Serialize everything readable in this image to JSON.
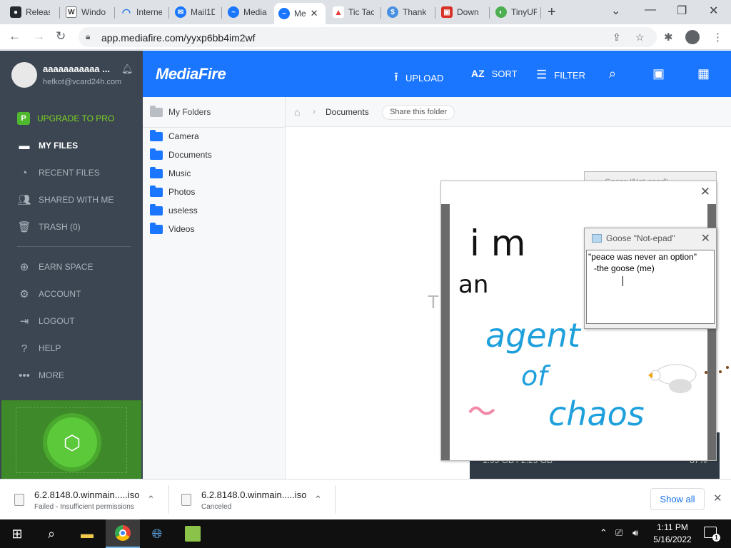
{
  "browser": {
    "tabs": [
      {
        "label": "Releas",
        "icon": "github-icon",
        "color": "#24292e"
      },
      {
        "label": "Windo",
        "icon": "wikipedia-icon",
        "color": "#555555"
      },
      {
        "label": "Interne",
        "icon": "loading-spinner-icon",
        "color": "#1a73e8"
      },
      {
        "label": "Mail1D",
        "icon": "mail-icon",
        "color": "#1a75ff"
      },
      {
        "label": "Media",
        "icon": "mediafire-icon",
        "color": "#1a75ff"
      },
      {
        "label": "Me",
        "icon": "mediafire-icon",
        "color": "#1a75ff"
      },
      {
        "label": "Tic Tac",
        "icon": "tictactoe-icon",
        "color": "#e8403a"
      },
      {
        "label": "Thank",
        "icon": "dollar-icon",
        "color": "#4a90e2"
      },
      {
        "label": "Down",
        "icon": "pdf-icon",
        "color": "#d93025"
      },
      {
        "label": "TinyUF",
        "icon": "tinyurl-icon",
        "color": "#4caf50"
      }
    ],
    "url": "app.mediafire.com/yyxp6bb4im2wf"
  },
  "user": {
    "name": "aaaaaaaaaaa ...",
    "email": "hefkot@vcard24h.com"
  },
  "sidebar": {
    "items": [
      {
        "label": "UPGRADE TO PRO",
        "icon": "pro-badge-icon"
      },
      {
        "label": "MY FILES",
        "icon": "folder-icon"
      },
      {
        "label": "RECENT FILES",
        "icon": "clock-icon"
      },
      {
        "label": "SHARED WITH ME",
        "icon": "people-icon"
      },
      {
        "label": "TRASH (0)",
        "icon": "trash-icon"
      },
      {
        "label": "EARN SPACE",
        "icon": "plus-circle-icon"
      },
      {
        "label": "ACCOUNT",
        "icon": "gear-icon"
      },
      {
        "label": "LOGOUT",
        "icon": "logout-icon"
      },
      {
        "label": "HELP",
        "icon": "help-icon"
      },
      {
        "label": "MORE",
        "icon": "more-dots-icon"
      }
    ]
  },
  "header": {
    "logo": "MediaFire",
    "upload": "UPLOAD",
    "sort": "SORT",
    "filter": "FILTER"
  },
  "folders": {
    "root": "My Folders",
    "items": [
      "Camera",
      "Documents",
      "Music",
      "Photos",
      "useless",
      "Videos"
    ]
  },
  "breadcrumb": {
    "current": "Documents",
    "share_label": "Share this folder"
  },
  "storage": {
    "used": "1.99 GB / 2.29 GB",
    "percent": "87%"
  },
  "ghost_text": "T",
  "notepad": {
    "title": "Goose \"Not-epad\"",
    "line1": "\"peace was never an option\"",
    "line2": "-the goose (me)"
  },
  "drawing": {
    "words": [
      "i m",
      "an",
      "agent",
      "of",
      "chaos"
    ],
    "colors": {
      "black": "#111111",
      "blue": "#1ea0dc",
      "pink": "#f08aa8"
    }
  },
  "downloads": [
    {
      "name": "6.2.8148.0.winmain.....iso",
      "status": "Failed - Insufficient permissions"
    },
    {
      "name": "6.2.8148.0.winmain.....iso",
      "status": "Canceled"
    }
  ],
  "shelf": {
    "show_all": "Show all"
  },
  "taskbar": {
    "time": "1:11 PM",
    "date": "5/16/2022",
    "notification_count": "1"
  }
}
